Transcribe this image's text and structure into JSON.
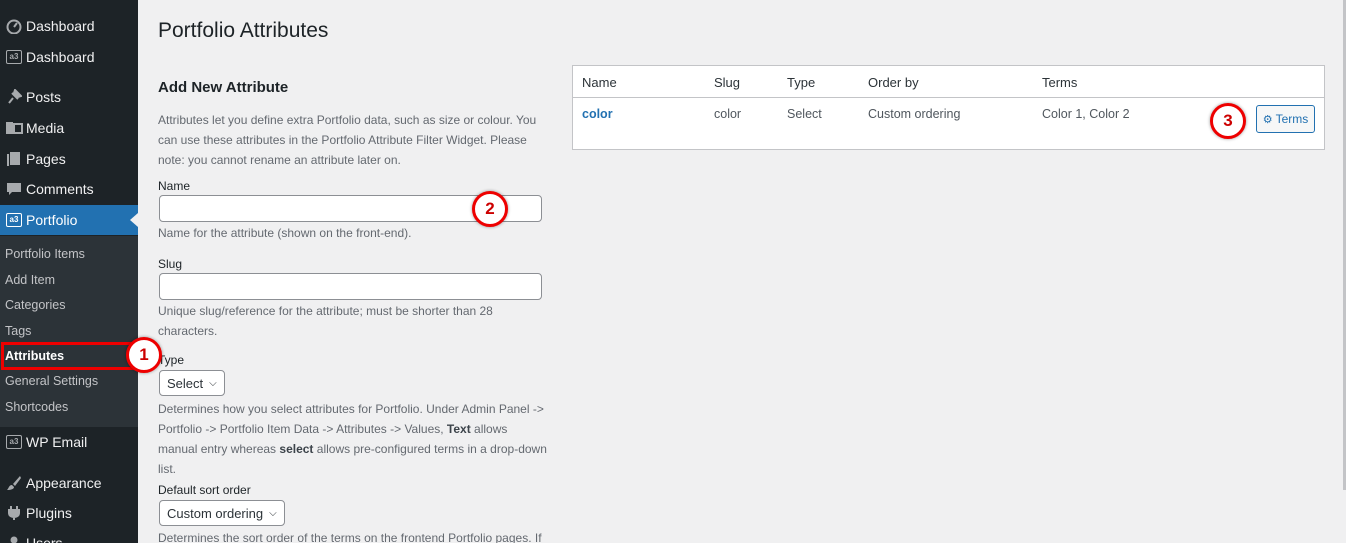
{
  "sidebar": {
    "items": [
      {
        "label": "Dashboard",
        "icon": "dashboard-icon"
      },
      {
        "label": "Dashboard",
        "icon": "a3-icon"
      },
      {
        "label": "Posts",
        "icon": "pin-icon"
      },
      {
        "label": "Media",
        "icon": "media-icon"
      },
      {
        "label": "Pages",
        "icon": "pages-icon"
      },
      {
        "label": "Comments",
        "icon": "comment-icon"
      },
      {
        "label": "Portfolio",
        "icon": "a3-icon"
      },
      {
        "label": "WP Email",
        "icon": "a3-icon"
      },
      {
        "label": "Appearance",
        "icon": "brush-icon"
      },
      {
        "label": "Plugins",
        "icon": "plug-icon"
      },
      {
        "label": "Users",
        "icon": "users-icon"
      }
    ],
    "a3_text": "a3",
    "submenu": [
      "Portfolio Items",
      "Add Item",
      "Categories",
      "Tags",
      "Attributes",
      "General Settings",
      "Shortcodes"
    ]
  },
  "page": {
    "title": "Portfolio Attributes",
    "add_heading": "Add New Attribute",
    "intro": "Attributes let you define extra Portfolio data, such as size or colour. You can use these attributes in the Portfolio Attribute Filter Widget. Please note: you cannot rename an attribute later on.",
    "name_label": "Name",
    "name_desc": "Name for the attribute (shown on the front-end).",
    "slug_label": "Slug",
    "slug_desc": "Unique slug/reference for the attribute; must be shorter than 28 characters.",
    "type_label": "Type",
    "type_value": "Select",
    "type_desc_1": "Determines how you select attributes for Portfolio. Under Admin Panel -> Portfolio -> Portfolio Item Data -> Attributes -> Values, ",
    "type_desc_text": "Text",
    "type_desc_2": " allows manual entry whereas ",
    "type_desc_select": "select",
    "type_desc_3": " allows pre-configured terms in a drop-down list.",
    "sort_label": "Default sort order",
    "sort_value": "Custom ordering",
    "sort_desc": "Determines the sort order of the terms on the frontend Portfolio pages. If"
  },
  "table": {
    "headers": [
      "Name",
      "Slug",
      "Type",
      "Order by",
      "Terms"
    ],
    "row": {
      "name": "color",
      "slug": "color",
      "type": "Select",
      "order_by": "Custom ordering",
      "terms": "Color 1, Color 2"
    },
    "terms_button": "Terms"
  },
  "callouts": [
    "1",
    "2",
    "3"
  ],
  "colors": {
    "sidebar_bg": "#1d2327",
    "active": "#2271b1",
    "callout": "#e00000"
  }
}
